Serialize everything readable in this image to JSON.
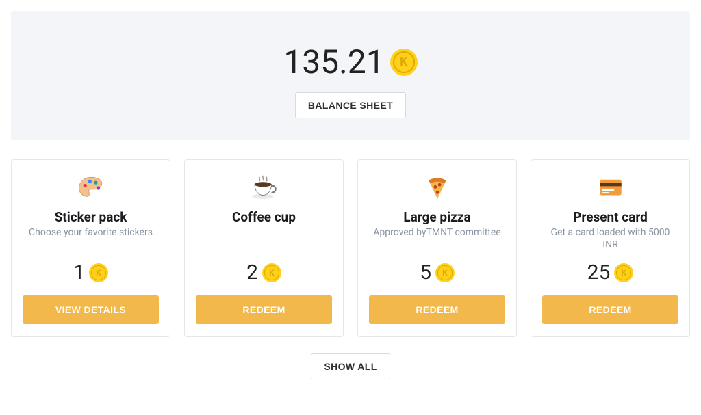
{
  "balance": {
    "amount": "135.21",
    "action_label": "BALANCE SHEET"
  },
  "rewards": [
    {
      "id": "sticker-pack",
      "title": "Sticker pack",
      "description": "Choose your favorite stickers",
      "price": "1",
      "action_label": "VIEW DETAILS",
      "icon": "palette"
    },
    {
      "id": "coffee-cup",
      "title": "Coffee cup",
      "description": "",
      "price": "2",
      "action_label": "REDEEM",
      "icon": "coffee"
    },
    {
      "id": "large-pizza",
      "title": "Large pizza",
      "description": "Approved byTMNT committee",
      "price": "5",
      "action_label": "REDEEM",
      "icon": "pizza"
    },
    {
      "id": "present-card",
      "title": "Present card",
      "description": "Get a card loaded with 5000 INR",
      "price": "25",
      "action_label": "REDEEM",
      "icon": "card"
    }
  ],
  "footer": {
    "show_all_label": "SHOW ALL"
  }
}
